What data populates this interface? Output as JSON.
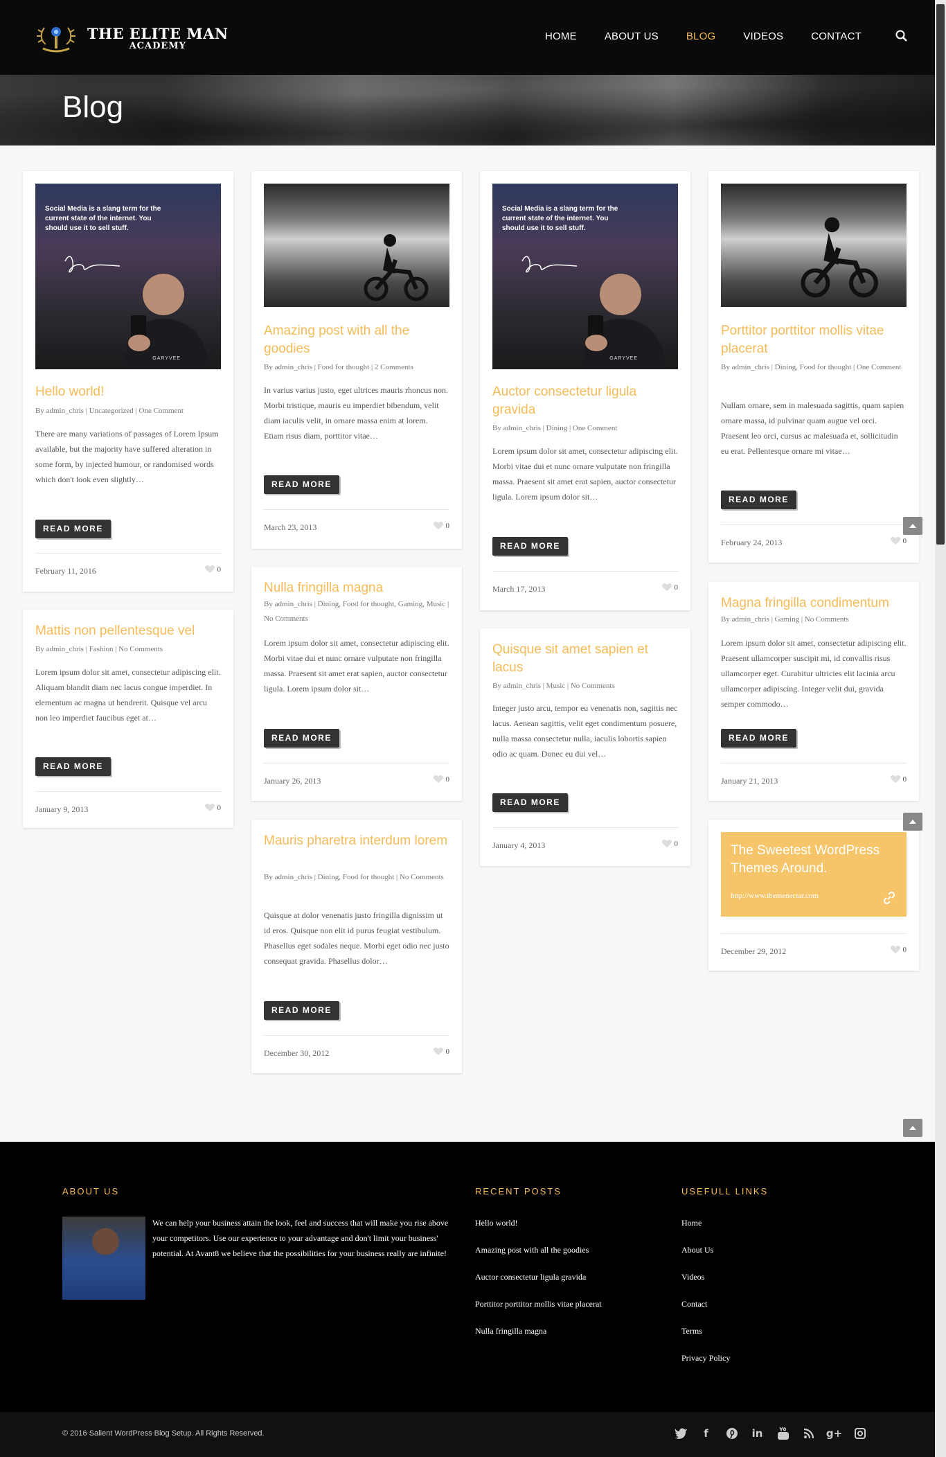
{
  "site": {
    "logo_line1": "THE ELITE MAN",
    "logo_line2": "ACADEMY"
  },
  "nav": {
    "items": [
      "HOME",
      "ABOUT US",
      "BLOG",
      "VIDEOS",
      "CONTACT"
    ],
    "active": "BLOG"
  },
  "page": {
    "title": "Blog"
  },
  "posts": [
    {
      "title": "Hello world!",
      "meta": "By admin_chris | Uncategorized | One Comment",
      "excerpt": "There are many variations of passages of Lorem Ipsum available, but the majority have suffered alteration in some form, by injected humour, or randomised words which don't look even slightly…",
      "date": "February 11, 2016",
      "likes": "0",
      "image_caption": "Social Media is a slang term for the current state of the internet. You should use it to sell stuff.",
      "image_credit": "GARYVEE"
    },
    {
      "title": "Mattis non pellentesque vel",
      "meta": "By admin_chris | Fashion | No Comments",
      "excerpt": "Lorem ipsum dolor sit amet, consectetur adipiscing elit. Aliquam blandit diam nec lacus congue imperdiet. In elementum ac magna ut hendrerit. Quisque vel arcu non leo imperdiet faucibus eget at…",
      "date": "January 9, 2013",
      "likes": "0"
    },
    {
      "title": "Amazing post with all the goodies",
      "meta": "By admin_chris | Food for thought | 2 Comments",
      "excerpt": "In varius varius justo, eget ultrices mauris rhoncus non. Morbi tristique, mauris eu imperdiet bibendum, velit diam iaculis velit, in ornare massa enim at lorem. Etiam risus diam, porttitor vitae…",
      "date": "March 23, 2013",
      "likes": "0"
    },
    {
      "title": "Nulla fringilla magna",
      "meta": "By admin_chris | Dining, Food for thought, Gaming, Music | No Comments",
      "excerpt": "Lorem ipsum dolor sit amet, consectetur adipiscing elit. Morbi vitae dui et nunc ornare vulputate non fringilla massa. Praesent sit amet erat sapien, auctor consectetur ligula. Lorem ipsum dolor sit…",
      "date": "January 26, 2013",
      "likes": "0"
    },
    {
      "title": "Mauris pharetra interdum lorem",
      "meta": "By admin_chris | Dining, Food for thought | No Comments",
      "excerpt": "Quisque at dolor venenatis justo fringilla dignissim ut id eros. Quisque non elit id purus feugiat vestibulum. Phasellus eget sodales neque. Morbi eget odio nec justo consequat gravida. Phasellus dolor…",
      "date": "December 30, 2012",
      "likes": "0"
    },
    {
      "title": "Auctor consectetur ligula gravida",
      "meta": "By admin_chris | Dining | One Comment",
      "excerpt": "Lorem ipsum dolor sit amet, consectetur adipiscing elit. Morbi vitae dui et nunc ornare vulputate non fringilla massa. Praesent sit amet erat sapien, auctor consectetur ligula. Lorem ipsum dolor sit…",
      "date": "March 17, 2013",
      "likes": "0",
      "image_caption": "Social Media is a slang term for the current state of the internet. You should use it to sell stuff.",
      "image_credit": "GARYVEE"
    },
    {
      "title": "Quisque sit amet sapien et lacus",
      "meta": "By admin_chris | Music | No Comments",
      "excerpt": "Integer justo arcu, tempor eu venenatis non, sagittis nec lacus. Aenean sagittis, velit eget condimentum posuere, nulla massa consectetur nulla, iaculis lobortis sapien odio ac quam. Donec eu dui vel…",
      "date": "January 4, 2013",
      "likes": "0"
    },
    {
      "title": "Porttitor porttitor mollis vitae placerat",
      "meta": "By admin_chris | Dining, Food for thought | One Comment",
      "excerpt": "Nullam ornare, sem in malesuada sagittis, quam sapien ornare massa, id pulvinar quam augue vel orci. Praesent leo orci, cursus ac malesuada et, sollicitudin eu erat. Pellentesque ornare mi vitae…",
      "date": "February 24, 2013",
      "likes": "0"
    },
    {
      "title": "Magna fringilla condimentum",
      "meta": "By admin_chris | Gaming | No Comments",
      "excerpt": "Lorem ipsum dolor sit amet, consectetur adipiscing elit. Praesent ullamcorper suscipit mi, id convallis risus ullamcorper eget. Curabitur ultricies elit lacinia arcu ullamcorper adipiscing. Integer velit dui, gravida semper commodo…",
      "date": "January 21, 2013",
      "likes": "0"
    },
    {
      "title": "The Sweetest WordPress Themes Around.",
      "url": "http://www.themenectar.com",
      "date": "December 29, 2012",
      "likes": "0"
    }
  ],
  "read_more_label": "READ MORE",
  "footer": {
    "about_heading": "ABOUT US",
    "about_text": "We can help your business attain the look, feel and success that will make you rise above your competitors. Use our experience to your advantage and don't limit your business' potential. At Avant8 we believe that the possibilities for your business really are infinite!",
    "recent_heading": "RECENT POSTS",
    "recent_posts": [
      "Hello world!",
      "Amazing post with all the goodies",
      "Auctor consectetur ligula gravida",
      "Porttitor porttitor mollis vitae placerat",
      "Nulla fringilla magna"
    ],
    "links_heading": "USEFULL LINKS",
    "links": [
      "Home",
      "About Us",
      "Videos",
      "Contact",
      "Terms",
      "Privacy Policy"
    ],
    "copyright": "© 2016 Salient WordPress Blog Setup. All Rights Reserved.",
    "social_icons": [
      "twitter-icon",
      "facebook-icon",
      "pinterest-icon",
      "linkedin-icon",
      "youtube-icon",
      "rss-icon",
      "google-plus-icon",
      "instagram-icon"
    ]
  },
  "colors": {
    "accent": "#f6bb57",
    "header_bg": "#0a0a0a",
    "link_box": "#f6c56a",
    "button_bg": "#333333"
  }
}
